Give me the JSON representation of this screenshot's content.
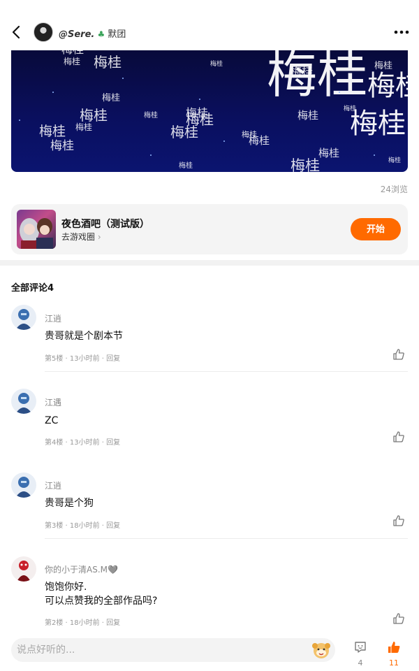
{
  "header": {
    "author_handle": "@Sere.",
    "author_suffix": "默团"
  },
  "banner": {
    "watermark_text": "梅桂"
  },
  "post": {
    "views": "24浏览"
  },
  "game": {
    "title": "夜色酒吧（测试版）",
    "subtitle": "去游戏圈",
    "start_label": "开始"
  },
  "comments_section": {
    "title": "全部评论4"
  },
  "comments": [
    {
      "name": "江逍",
      "text": "贵哥就是个剧本节",
      "meta": "第5楼 · 13小时前 · 回复"
    },
    {
      "name": "江遇",
      "text": "ZC",
      "meta": "第4楼 · 13小时前 · 回复"
    },
    {
      "name": "江逍",
      "text": "贵哥是个狗",
      "meta": "第3楼 · 18小时前 · 回复"
    },
    {
      "name": "你的小于清AS.M🩶",
      "text": "饱饱你好.\n可以点赞我的全部作品吗?",
      "meta": "第2楼 · 18小时前 · 回复"
    }
  ],
  "bottom_bar": {
    "input_placeholder": "说点好听的...",
    "comment_count": "4",
    "like_count": "11"
  },
  "colors": {
    "accent": "#ff6a00",
    "banner_bg": "#0a0f5e"
  }
}
